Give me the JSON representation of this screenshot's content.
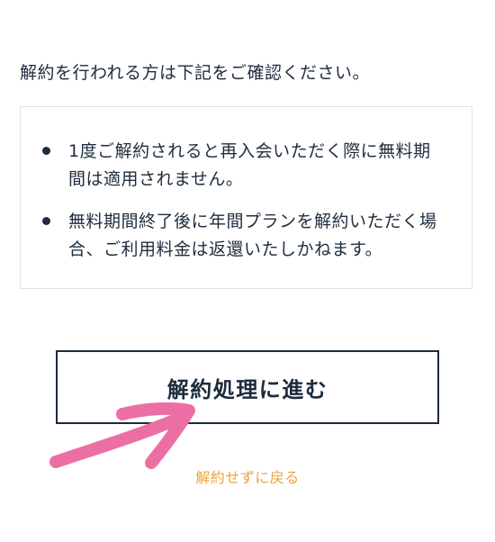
{
  "intro": {
    "text": "解約を行われる方は下記をご確認ください。"
  },
  "notices": [
    {
      "text": "1度ご解約されると再入会いただく際に無料期間は適用されません。"
    },
    {
      "text": "無料期間終了後に年間プランを解約いただく場合、ご利用料金は返還いたしかねます。"
    }
  ],
  "actions": {
    "proceed_label": "解約処理に進む",
    "back_label": "解約せずに戻る"
  },
  "colors": {
    "text": "#1c2b3d",
    "link": "#e8a33c",
    "annotation_arrow": "#ec6fa3",
    "box_border": "#dde1e5"
  },
  "annotation": {
    "icon": "arrow-pointer-icon"
  }
}
